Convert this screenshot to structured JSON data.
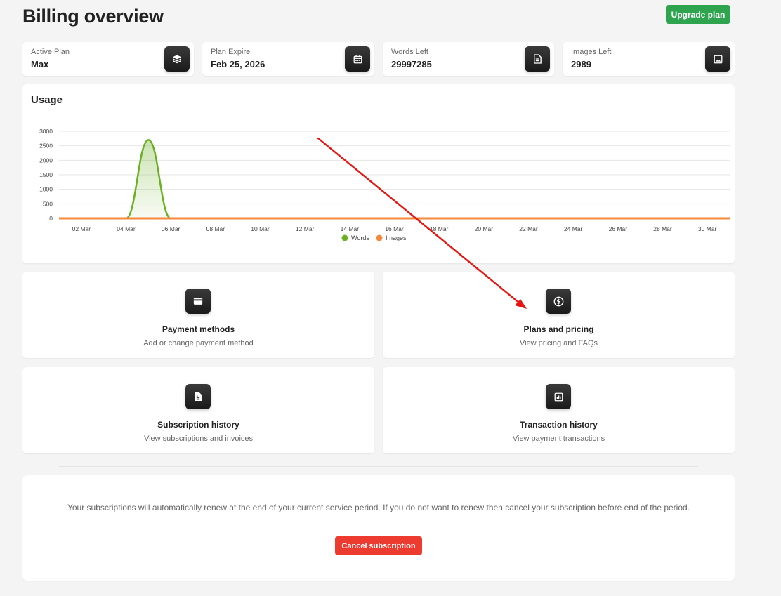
{
  "page": {
    "title": "Billing overview",
    "upgrade_label": "Upgrade plan"
  },
  "stats": [
    {
      "label": "Active Plan",
      "value": "Max",
      "icon": "layers-icon"
    },
    {
      "label": "Plan Expire",
      "value": "Feb 25, 2026",
      "icon": "calendar-icon"
    },
    {
      "label": "Words Left",
      "value": "29997285",
      "icon": "document-icon"
    },
    {
      "label": "Images Left",
      "value": "2989",
      "icon": "image-icon"
    }
  ],
  "usage": {
    "title": "Usage",
    "chart_data": {
      "type": "area",
      "title": "Usage",
      "x": [
        "01 Mar",
        "02 Mar",
        "03 Mar",
        "04 Mar",
        "05 Mar",
        "06 Mar",
        "07 Mar",
        "08 Mar",
        "09 Mar",
        "10 Mar",
        "11 Mar",
        "12 Mar",
        "13 Mar",
        "14 Mar",
        "15 Mar",
        "16 Mar",
        "17 Mar",
        "18 Mar",
        "19 Mar",
        "20 Mar",
        "21 Mar",
        "22 Mar",
        "23 Mar",
        "24 Mar",
        "25 Mar",
        "26 Mar",
        "27 Mar",
        "28 Mar",
        "29 Mar",
        "30 Mar",
        "31 Mar"
      ],
      "x_tick_labels": [
        "02 Mar",
        "04 Mar",
        "06 Mar",
        "08 Mar",
        "10 Mar",
        "12 Mar",
        "14 Mar",
        "16 Mar",
        "18 Mar",
        "20 Mar",
        "22 Mar",
        "24 Mar",
        "26 Mar",
        "28 Mar",
        "30 Mar"
      ],
      "series": [
        {
          "name": "Words",
          "color": "#6ab023",
          "values": [
            0,
            0,
            0,
            0,
            2700,
            0,
            0,
            0,
            0,
            0,
            0,
            0,
            0,
            0,
            0,
            0,
            0,
            0,
            0,
            0,
            0,
            0,
            0,
            0,
            0,
            0,
            0,
            0,
            0,
            0,
            0
          ]
        },
        {
          "name": "Images",
          "color": "#f5883a",
          "values": [
            0,
            0,
            0,
            0,
            0,
            0,
            0,
            0,
            0,
            0,
            0,
            0,
            0,
            0,
            0,
            0,
            0,
            0,
            0,
            0,
            0,
            0,
            0,
            0,
            0,
            0,
            0,
            0,
            0,
            0,
            0
          ]
        }
      ],
      "yticks": [
        0,
        500,
        1000,
        1500,
        2000,
        2500,
        3000
      ],
      "ylim": [
        0,
        3000
      ],
      "grid": true,
      "legend": "bottom-center"
    }
  },
  "actions": [
    {
      "title": "Payment methods",
      "subtitle": "Add or change payment method",
      "icon": "credit-card-icon"
    },
    {
      "title": "Plans and pricing",
      "subtitle": "View pricing and FAQs",
      "icon": "dollar-circle-icon"
    },
    {
      "title": "Subscription history",
      "subtitle": "View subscriptions and invoices",
      "icon": "invoice-icon"
    },
    {
      "title": "Transaction history",
      "subtitle": "View payment transactions",
      "icon": "bar-chart-icon"
    }
  ],
  "notice": {
    "text": "Your subscriptions will automatically renew at the end of your current service period. If you do not want to renew then cancel your subscription before end of the period.",
    "cancel_label": "Cancel subscription"
  },
  "colors": {
    "accent_green": "#2ea44f",
    "danger_red": "#ee3b30",
    "annotation_arrow": "#e8140f"
  }
}
